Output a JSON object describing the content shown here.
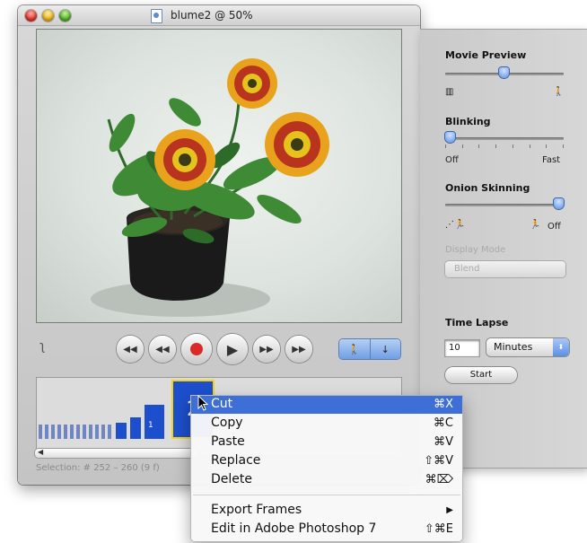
{
  "window": {
    "title": "blume2 @ 50%"
  },
  "transport": {
    "buttons": [
      "rewind-to-start",
      "step-back",
      "record",
      "play",
      "step-forward",
      "fast-forward-to-end"
    ]
  },
  "timeline": {
    "selected_frame_label": "2",
    "small_frame_label": "1",
    "selection_status": "Selection: # 252 – 260 (9 f)"
  },
  "drawer": {
    "movie_preview": {
      "label": "Movie Preview",
      "level": 0.5
    },
    "blinking": {
      "label": "Blinking",
      "min_label": "Off",
      "max_label": "Fast",
      "level": 0.0
    },
    "onion_skinning": {
      "label": "Onion Skinning",
      "off_label": "Off",
      "level": 1.0
    },
    "display_mode": {
      "label": "Display Mode",
      "value": "Blend"
    },
    "time_lapse": {
      "label": "Time Lapse",
      "interval": "10",
      "unit": "Minutes",
      "start_label": "Start"
    }
  },
  "context_menu": {
    "items": [
      {
        "label": "Cut",
        "shortcut": "⌘X",
        "highlighted": true
      },
      {
        "label": "Copy",
        "shortcut": "⌘C"
      },
      {
        "label": "Paste",
        "shortcut": "⌘V"
      },
      {
        "label": "Replace",
        "shortcut": "⇧⌘V"
      },
      {
        "label": "Delete",
        "shortcut": "⌘⌦"
      },
      {
        "label": "Export Frames",
        "shortcut": "▶"
      },
      {
        "label": "Edit in Adobe Photoshop 7",
        "shortcut": "⇧⌘E"
      }
    ]
  },
  "colors": {
    "highlight": "#3d6fd6",
    "frame_bar": "#1d4fcc",
    "record": "#d92a2a"
  }
}
